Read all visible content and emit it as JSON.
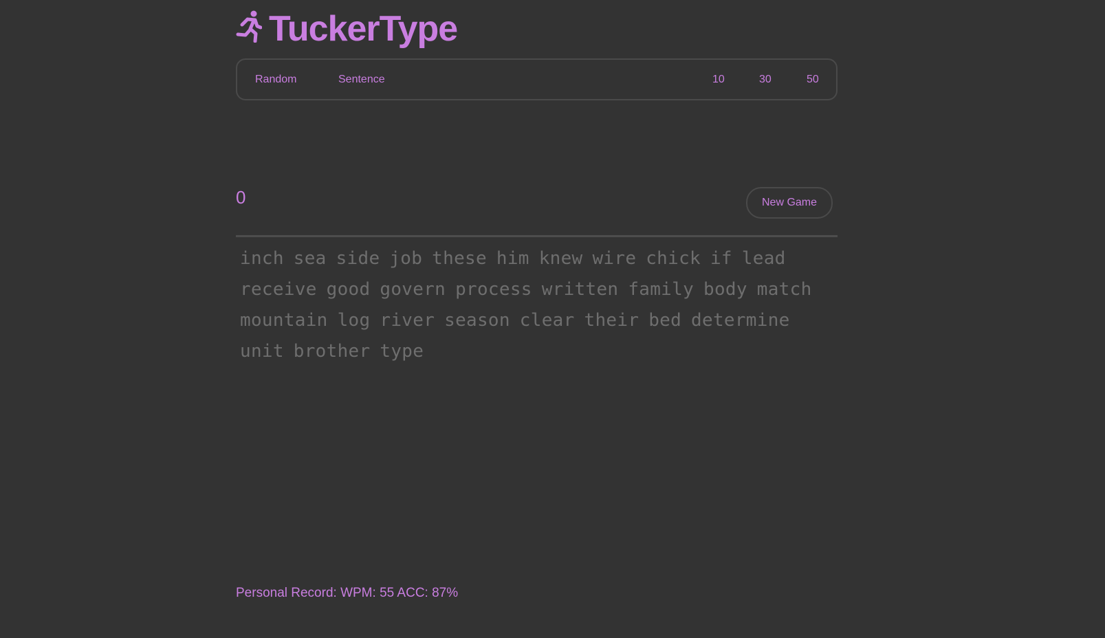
{
  "app": {
    "title": "TuckerType",
    "accent_color": "#c97ee0",
    "background_color": "#333333",
    "logo_icon": "running-person-icon"
  },
  "toolbar": {
    "mode_random": "Random",
    "mode_sentence": "Sentence",
    "count_10": "10",
    "count_30": "30",
    "count_50": "50"
  },
  "game": {
    "counter": "0",
    "new_game_label": "New Game",
    "words": "inch sea side job these him knew wire chick if lead receive good govern process written family body match mountain log river season clear their bed determine unit brother type"
  },
  "footer": {
    "personal_record": "Personal Record: WPM: 55 ACC: 87%"
  }
}
